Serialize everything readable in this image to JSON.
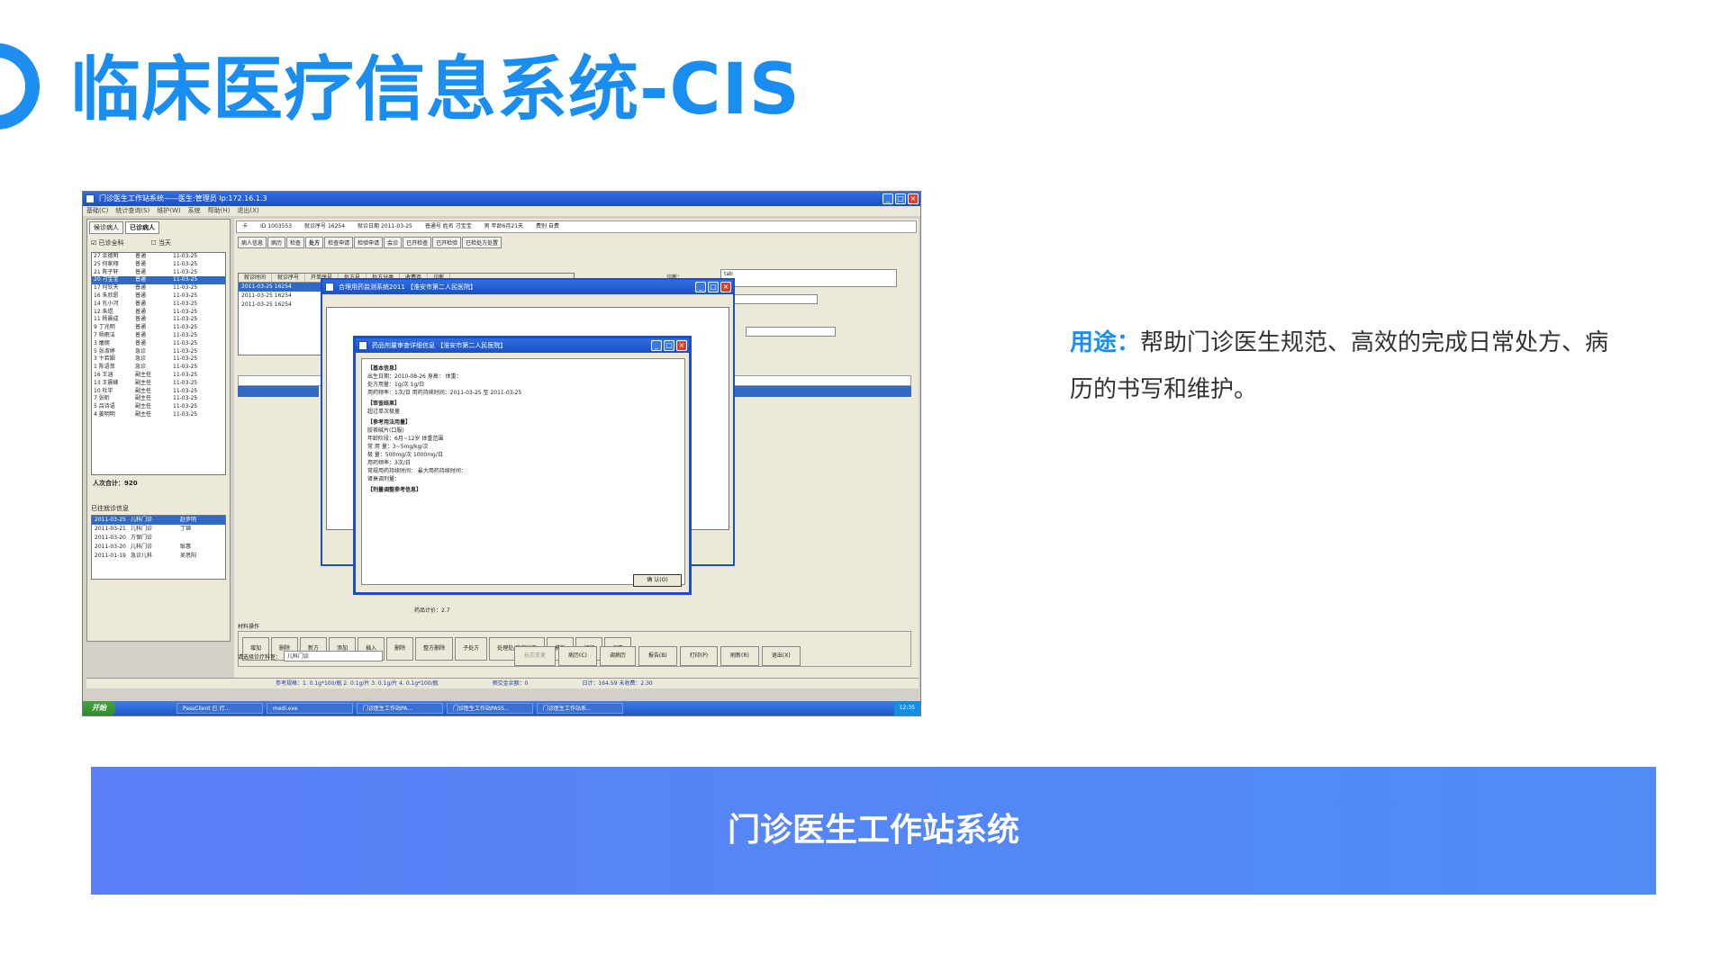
{
  "slide": {
    "title": "临床医疗信息系统-CIS",
    "description_label": "用途：",
    "description_text": "帮助门诊医生规范、高效的完成日常处方、病历的书写和维护。",
    "banner_text": "门诊医生工作站系统"
  },
  "screenshot": {
    "window_title": "门诊医生工作站系统——医生:管理员  Ip:172.16.1.3",
    "menu": [
      "基础(C)",
      "统计查询(S)",
      "维护(W)",
      "系统",
      "帮助(H)",
      "退出(X)"
    ],
    "left_tabs": [
      "候诊病人",
      "已诊病人"
    ],
    "check_all": "☑ 已诊全科",
    "check_today": "☐ 当天",
    "patients": [
      [
        "27 余德明",
        "普通",
        "11-03-25"
      ],
      [
        "25 何家翔",
        "普通",
        "11-03-25"
      ],
      [
        "21 陈子轩",
        "普通",
        "11-03-25"
      ],
      [
        "20 刁宝宝",
        "普通",
        "11-03-25"
      ],
      [
        "17 何钦天",
        "普通",
        "11-03-25"
      ],
      [
        "16 朱欣愿",
        "普通",
        "11-03-25"
      ],
      [
        "14 孔小河",
        "普通",
        "11-03-25"
      ],
      [
        "12 朱煜",
        "普通",
        "11-03-25"
      ],
      [
        "11 杨晨成",
        "普通",
        "11-03-25"
      ],
      [
        "9 丁兆明",
        "普通",
        "11-03-25"
      ],
      [
        "7 杨雨洁",
        "普通",
        "11-03-25"
      ],
      [
        "3 屠朗",
        "普通",
        "11-03-25"
      ],
      [
        "5 张淑婷",
        "急诊",
        "11-03-25"
      ],
      [
        "3 卞若姻",
        "急诊",
        "11-03-25"
      ],
      [
        "1 陈语菲",
        "急诊",
        "11-03-25"
      ],
      [
        "16 王涵",
        "副主任",
        "11-03-25"
      ],
      [
        "13 王晨峰",
        "副主任",
        "11-03-25"
      ],
      [
        "10 杜宇",
        "副主任",
        "11-03-25"
      ],
      [
        "7 张昕",
        "副主任",
        "11-03-25"
      ],
      [
        "5 吕诗语",
        "副主任",
        "11-03-25"
      ],
      [
        "4 姜明明",
        "副主任",
        "11-03-25"
      ]
    ],
    "selected_patient_index": 3,
    "total": "人次合计：920",
    "history_label": "已往就诊信息",
    "history": [
      [
        "2011-03-25",
        "儿科门诊",
        "赵步明"
      ],
      [
        "2011-03-21",
        "儿科门诊",
        "丁锦"
      ],
      [
        "2011-03-20",
        "方保门诊",
        ""
      ],
      [
        "2011-03-20",
        "儿科门诊",
        "耿惠"
      ],
      [
        "2011-01-19",
        "急诊儿科",
        "吴思阳"
      ]
    ],
    "info_bar": [
      "卡",
      "ID 1003553",
      "就诊序号 16254",
      "就诊日期 2011-03-25",
      "普通号 姓名 刁宝宝",
      "男 年龄6月21天",
      "费别 自费"
    ],
    "right_tabs": [
      "病人信息",
      "病历",
      "检查",
      "处方",
      "检查申请",
      "检验申请",
      "会诊",
      "已开检查",
      "已开检验",
      "已检处方处置"
    ],
    "rx_columns": [
      "就诊时间",
      "就诊序号",
      "开单序号",
      "处方号",
      "处方分类",
      "收费否",
      "诊断"
    ],
    "rx_rows": [
      "2011-03-25   16254",
      "2011-03-25   16254",
      "2011-03-25   16254"
    ],
    "diag_label": "诊断：",
    "diag_value": "tab",
    "ops_label": "材料操作",
    "ops_buttons": [
      "增加",
      "删除",
      "新方",
      "添加",
      "插入",
      "删除",
      "整方删除",
      "子处方",
      "处理处/确定状态",
      "模板",
      "打印",
      "保存"
    ],
    "total_price": "药品计价：2.7",
    "dept_label": "请选择诊疗科室：",
    "dept_value": "儿科门诊",
    "bottom_buttons": [
      "标志变更",
      "病历(C)",
      "调病历",
      "报告(B)",
      "打印(P)",
      "刷新(R)",
      "退出(X)"
    ],
    "status": [
      "参考规格：1. 0.1g*100/瓶  2. 0.1g/片  3. 0.1g/片  4. 0.1g*100/瓶",
      "预交金余额：0",
      "日计：164.59  未收费：2.30"
    ],
    "start_label": "开始",
    "tasks": [
      "PassClient 已 打...",
      "medi.exe",
      "门诊医生工作站PA...",
      "门诊医生工作站PASS...",
      "门诊医生工作站系..."
    ],
    "clock": "12:35",
    "dialog1_title": "合理用药监测系统2011 【淮安市第二人民医院】",
    "dialog2_title": "药品剂量审查详细信息 【淮安市第二人民医院】",
    "dialog2_lines": [
      "【基本信息】",
      "出生日期：2010-08-26      身高：        体重：",
      "处方用量：1g/次            1g/日",
      "用药频率：1次/日          用药持续时间：2011-03-25 至 2011-03-25",
      "【审查结果】",
      "超过单次极量",
      "【参考用法用量】",
      "胶茶碱片(口服)",
      "年龄阶段：6月~12岁       体重范围",
      "常 用 量：3~5mg/kg/次",
      "极    量：500mg/次       1000mg/日",
      "用药频率：3次/日",
      "常规用药持续时间：        最大用药持续时间：",
      "肾衰调剂量：",
      "【剂量调整参考信息】"
    ],
    "dialog2_ok": "确 认(O)"
  }
}
